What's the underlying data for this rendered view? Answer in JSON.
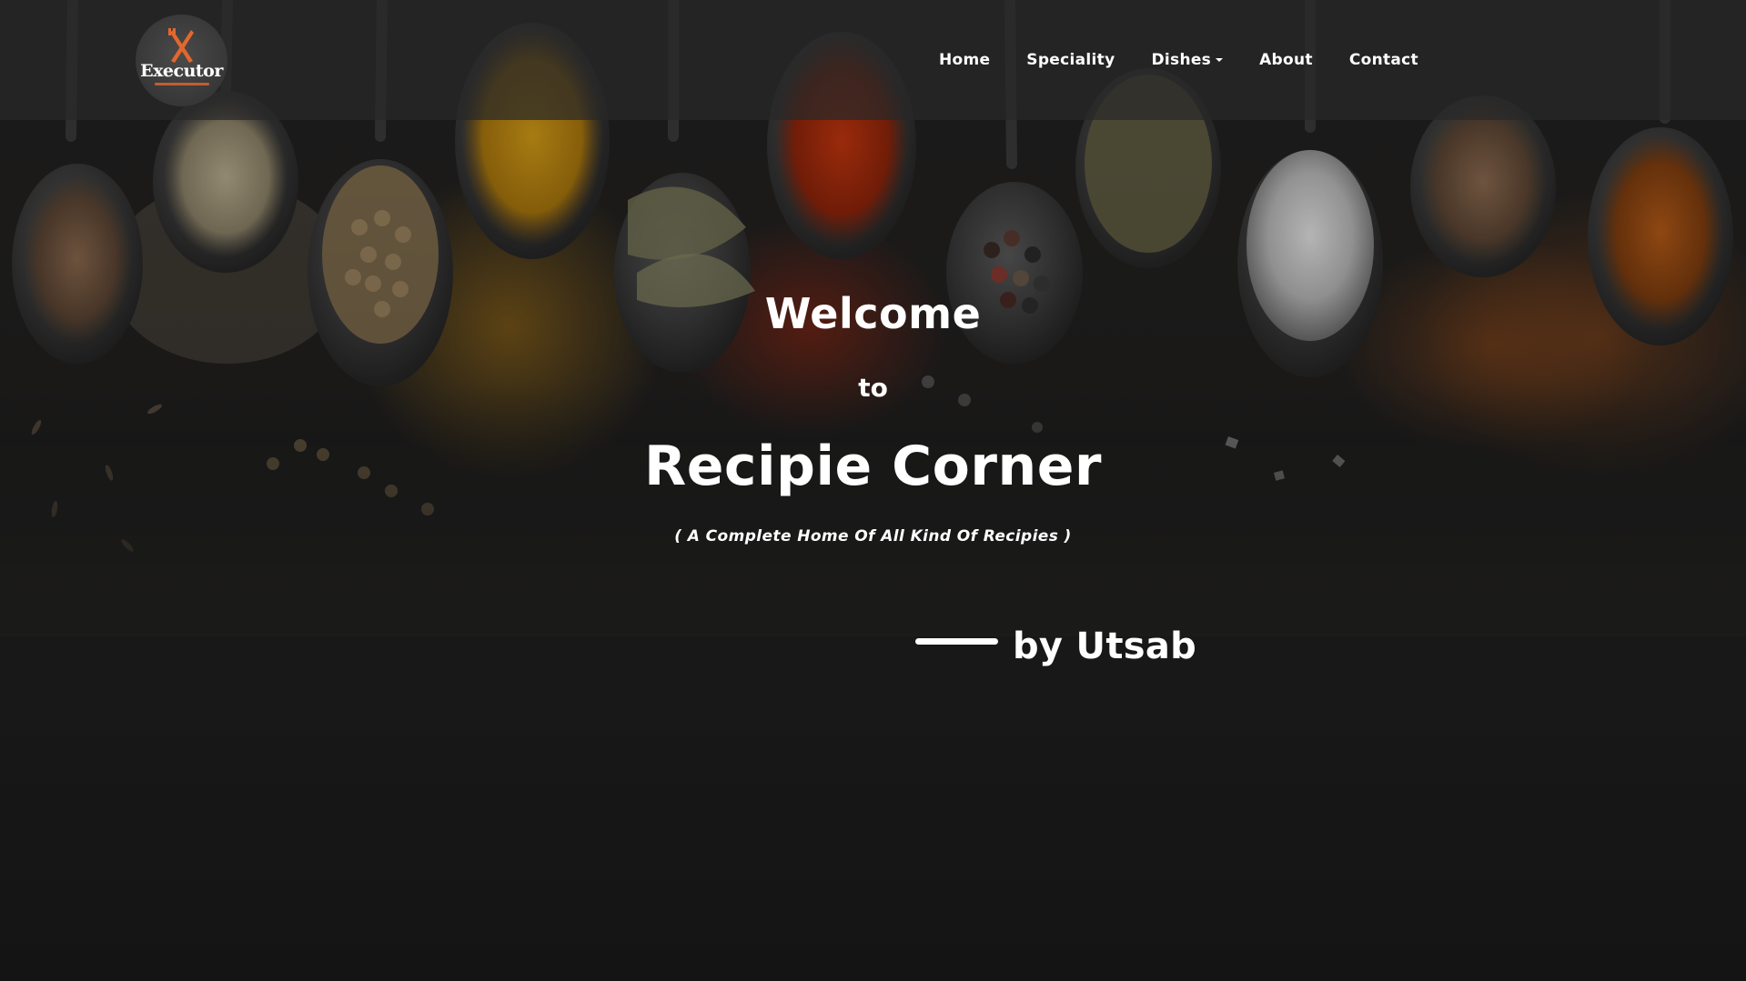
{
  "brand": {
    "logo_text": "Executor",
    "accent_color": "#e2672d"
  },
  "nav": {
    "items": [
      {
        "label": "Home"
      },
      {
        "label": "Speciality"
      },
      {
        "label": "Dishes",
        "dropdown": true
      },
      {
        "label": "About"
      },
      {
        "label": "Contact"
      }
    ]
  },
  "hero": {
    "welcome": "Welcome",
    "to": "to",
    "title": "Recipie Corner",
    "tagline": "( A Complete Home Of All Kind Of Recipies )",
    "byline": "by Utsab"
  },
  "background": {
    "theme": "spices-on-dark-slate",
    "base_color": "#161616"
  }
}
